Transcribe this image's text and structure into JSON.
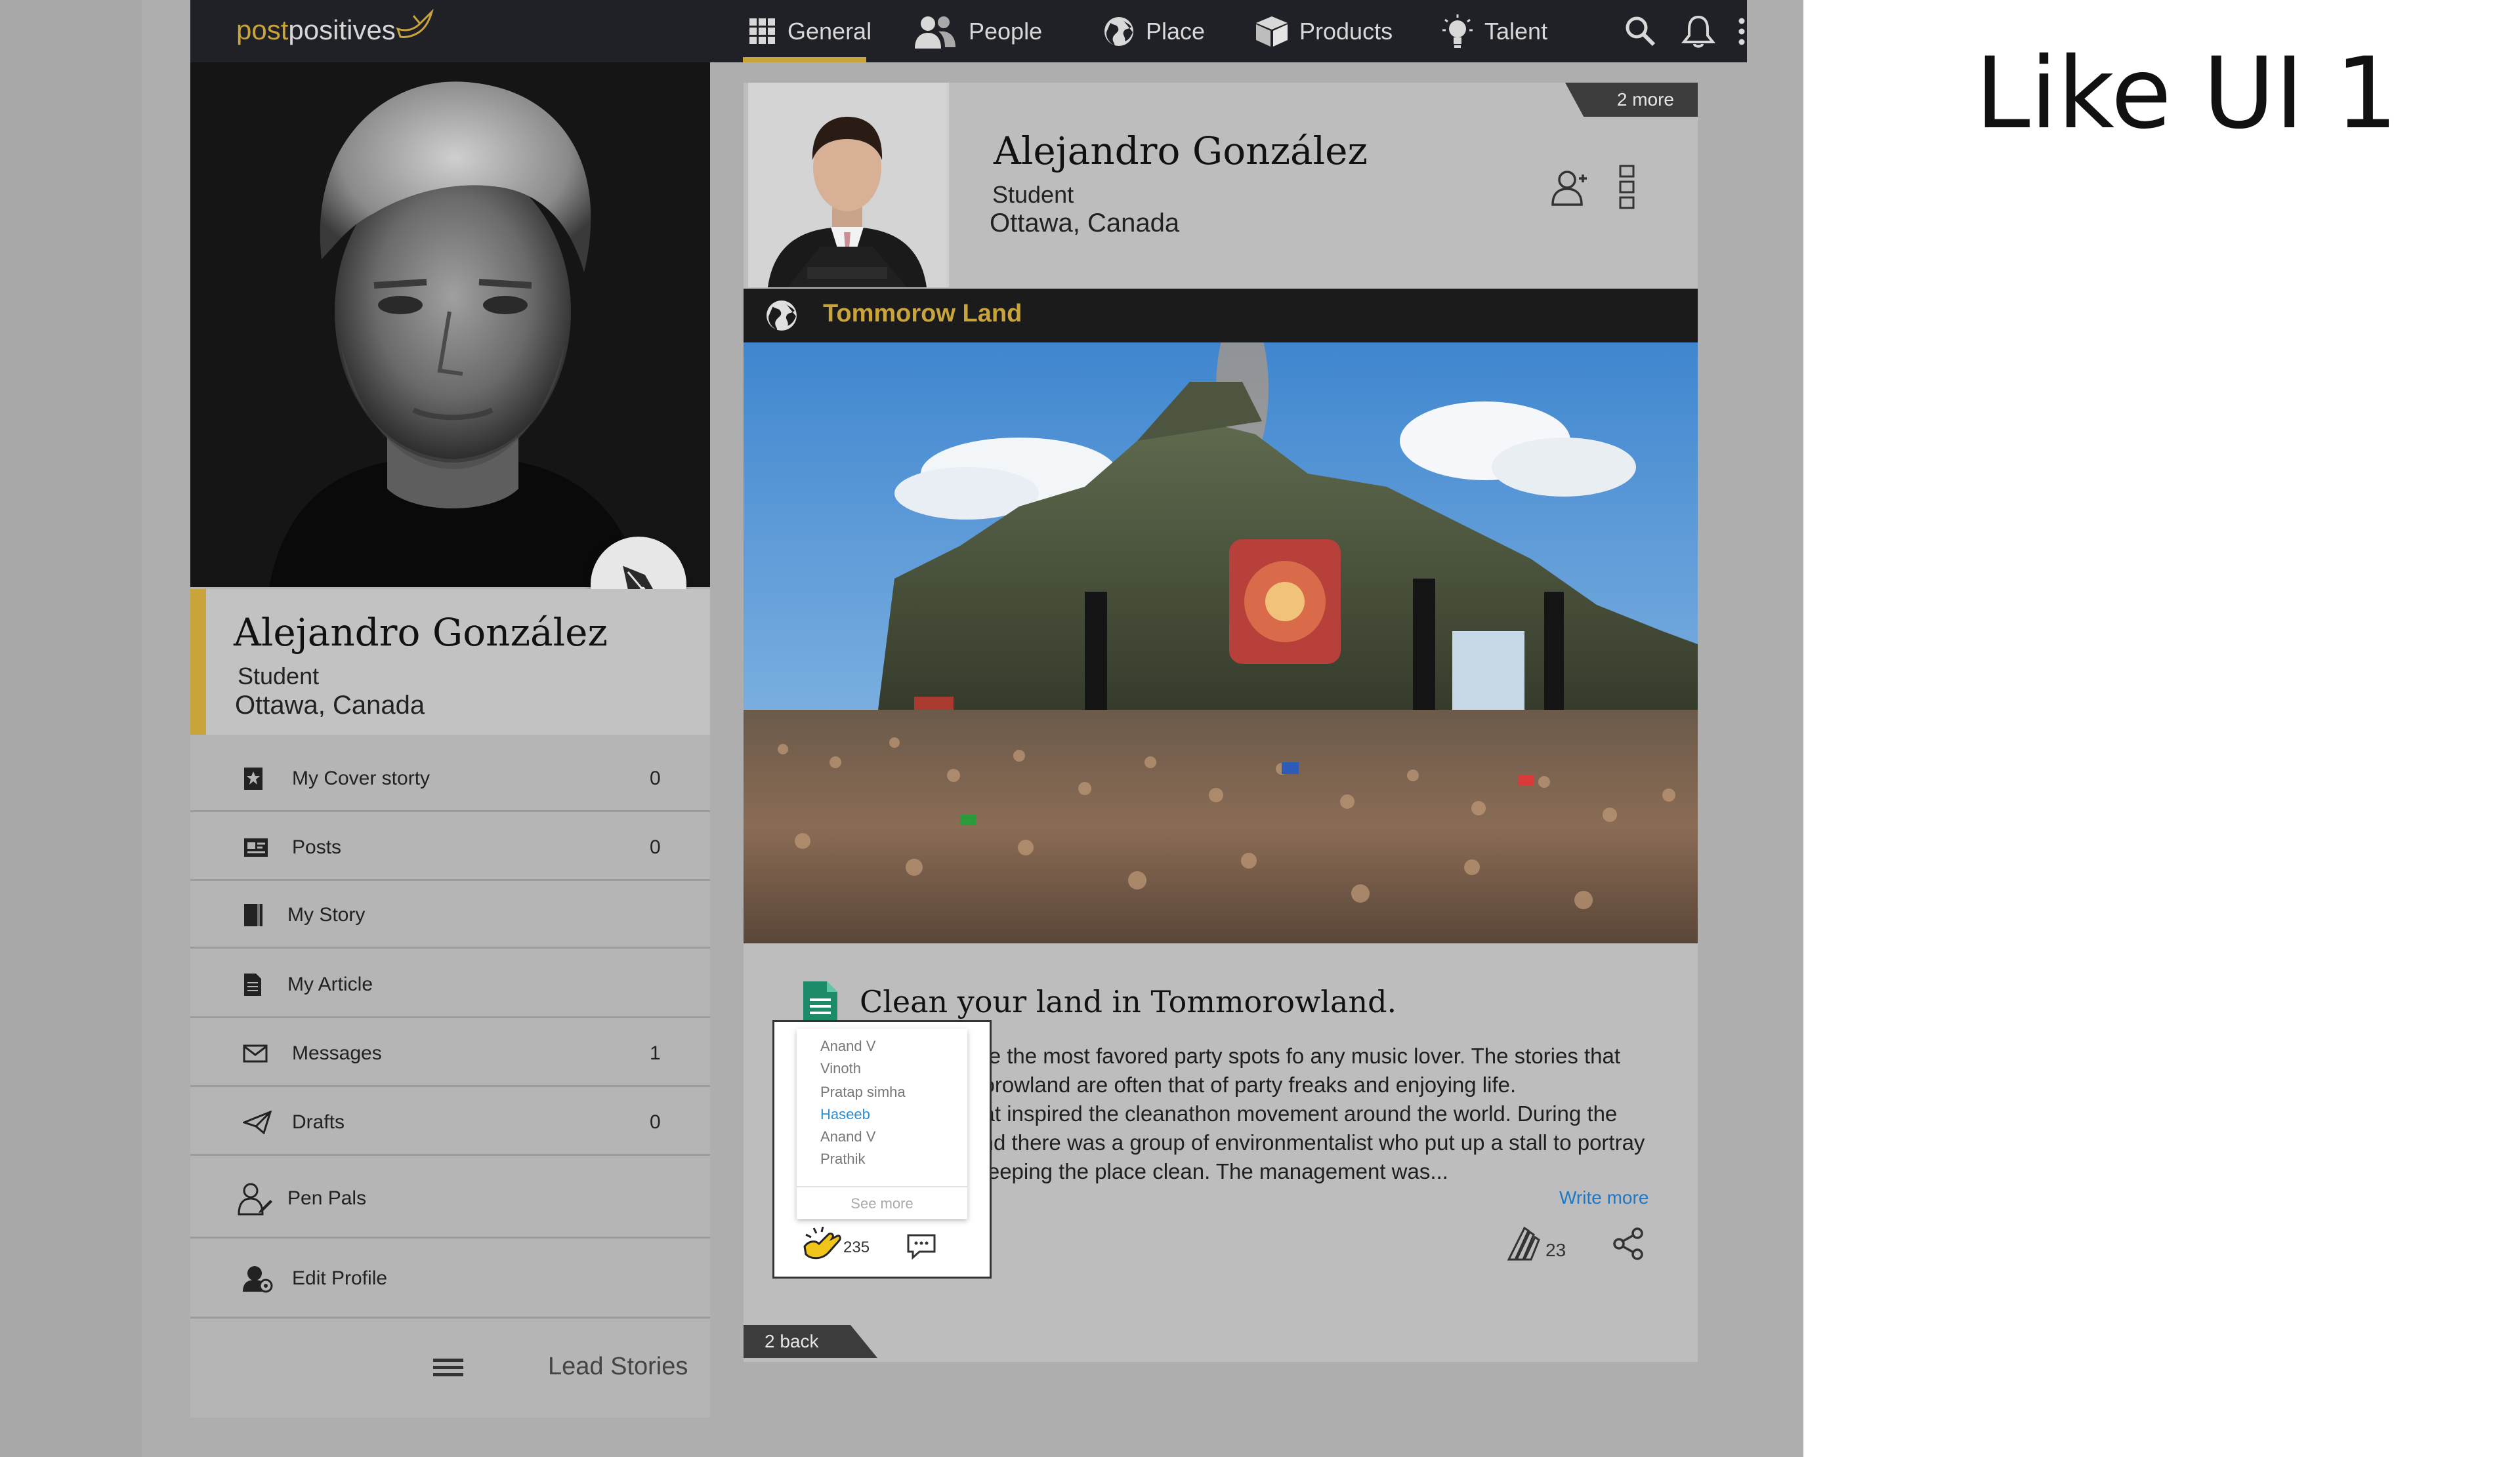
{
  "slide_title": "Like UI 1",
  "brand": {
    "logo_post": "post",
    "logo_positives": "positives"
  },
  "nav": {
    "items": [
      {
        "label": "General",
        "icon": "grid-icon",
        "active": true
      },
      {
        "label": "People",
        "icon": "people-icon"
      },
      {
        "label": "Place",
        "icon": "globe-icon"
      },
      {
        "label": "Products",
        "icon": "box-icon"
      },
      {
        "label": "Talent",
        "icon": "lightbulb-icon"
      }
    ]
  },
  "profile": {
    "name": "Alejandro González",
    "role": "Student",
    "location": "Ottawa, Canada"
  },
  "sidebar": {
    "items": [
      {
        "label": "My Cover storty",
        "count": "0",
        "icon": "cover-story-icon"
      },
      {
        "label": "Posts",
        "count": "0",
        "icon": "posts-icon"
      },
      {
        "label": "My Story",
        "count": "",
        "icon": "book-icon"
      },
      {
        "label": "My Article",
        "count": "",
        "icon": "article-icon"
      },
      {
        "label": "Messages",
        "count": "1",
        "icon": "envelope-icon"
      },
      {
        "label": "Drafts",
        "count": "0",
        "icon": "paper-plane-icon"
      },
      {
        "label": "Pen Pals",
        "count": "",
        "icon": "pen-pals-icon"
      },
      {
        "label": "Edit Profile",
        "count": "",
        "icon": "edit-profile-icon"
      }
    ],
    "lead_stories": "Lead Stories"
  },
  "post": {
    "more_tag": "2 more",
    "back_tag": "2 back",
    "author": {
      "name": "Alejandro González",
      "role": "Student",
      "location": "Ottawa, Canada"
    },
    "place": "Tommorow Land",
    "article_title": "Clean your land in Tommorowland.",
    "article_lines": [
      "one the most favored party spots fo any music lover. The stories that",
      "morowland are often that of party freaks and enjoying life.",
      "that inspired the cleanathon movement around the world. During the",
      "land there was a group of environmentalist who put up a stall to portray",
      "f keeping the place clean. The management was..."
    ],
    "write_more": "Write more",
    "tribute_count": "23",
    "like_count": "235"
  },
  "likes_popover": {
    "names": [
      {
        "name": "Anand V",
        "highlight": false
      },
      {
        "name": "Vinoth",
        "highlight": false
      },
      {
        "name": "Pratap simha",
        "highlight": false
      },
      {
        "name": "Haseeb",
        "highlight": true
      },
      {
        "name": "Anand V",
        "highlight": false
      },
      {
        "name": "Prathik",
        "highlight": false
      }
    ],
    "see_more": "See more"
  },
  "colors": {
    "accent_gold": "#c9a43a",
    "nav_bg": "#1f2126",
    "link_blue": "#1e78c8",
    "highlight_blue": "#2a8fd6"
  }
}
